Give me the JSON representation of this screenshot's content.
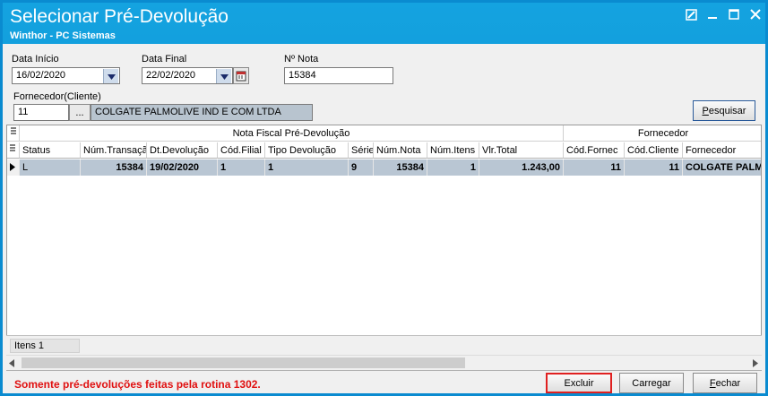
{
  "window": {
    "title": "Selecionar Pré-Devolução",
    "subtitle": "Winthor - PC Sistemas"
  },
  "filters": {
    "data_inicio_label": "Data Início",
    "data_inicio_value": "16/02/2020",
    "data_final_label": "Data Final",
    "data_final_value": "22/02/2020",
    "nota_label": "Nº Nota",
    "nota_value": "15384",
    "fornecedor_label": "Fornecedor(Cliente)",
    "fornecedor_code": "11",
    "lookup_label": "...",
    "fornecedor_name": "COLGATE PALMOLIVE IND E COM LTDA",
    "pesquisar_label": "Pesquisar"
  },
  "grid": {
    "band_nota": "Nota Fiscal Pré-Devolução",
    "band_fornecedor": "Fornecedor",
    "columns": {
      "status": "Status",
      "num_transacao": "Núm.Transaçã",
      "dt_devolucao": "Dt.Devolução",
      "cod_filial": "Cód.Filial",
      "tipo_devolucao": "Tipo Devolução",
      "serie": "Série",
      "num_nota": "Núm.Nota",
      "num_itens": "Núm.Itens",
      "vlr_total": "Vlr.Total",
      "cod_fornec": "Cód.Fornec",
      "cod_cliente": "Cód.Cliente",
      "fornecedor": "Fornecedor"
    },
    "rows": [
      {
        "status": "L",
        "num_transacao": "15384",
        "dt_devolucao": "19/02/2020",
        "cod_filial": "1",
        "tipo_devolucao": "1",
        "serie": "9",
        "num_nota": "15384",
        "num_itens": "1",
        "vlr_total": "1.243,00",
        "cod_fornec": "11",
        "cod_cliente": "11",
        "fornecedor": "COLGATE PALMOLIVE IND E COM LTDA"
      }
    ],
    "footer_itens": "Itens 1"
  },
  "message": "Somente pré-devoluções feitas pela rotina 1302.",
  "buttons": {
    "excluir": "Excluir",
    "carregar": "Carregar",
    "fechar": "Fechar"
  },
  "colors": {
    "title_bar": "#0a8bd0",
    "selected_row": "#b9c6d3",
    "message": "#e01010",
    "highlight_border": "#e02020"
  }
}
